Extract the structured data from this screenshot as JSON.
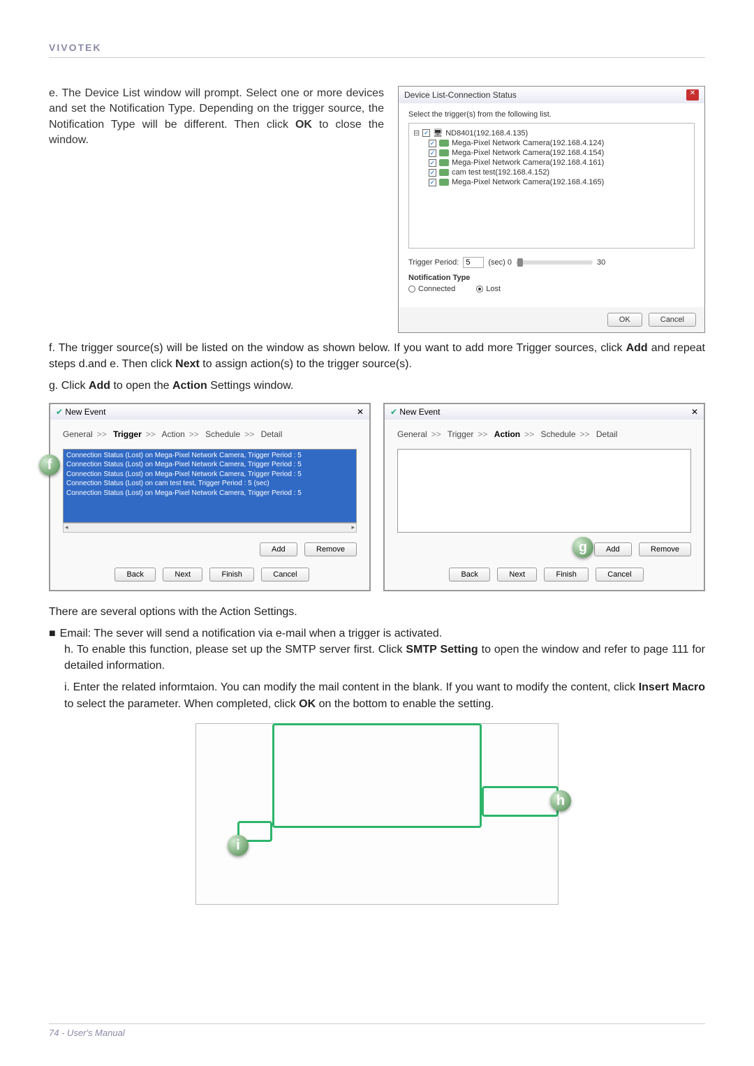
{
  "header": {
    "brand": "VIVOTEK"
  },
  "para_e": {
    "prefix": "e. The Device List window will prompt. Select one or more devices and set the Notification Type. Depending on the trigger source, the Notification Type will be different. Then click ",
    "ok": "OK",
    "suffix": " to close the window."
  },
  "device_dialog": {
    "title": "Device List-Connection Status",
    "instruction": "Select the trigger(s) from the following list.",
    "root": "ND8401(192.168.4.135)",
    "items": [
      "Mega-Pixel Network Camera(192.168.4.124)",
      "Mega-Pixel Network Camera(192.168.4.154)",
      "Mega-Pixel Network Camera(192.168.4.161)",
      "cam test test(192.168.4.152)",
      "Mega-Pixel Network Camera(192.168.4.165)"
    ],
    "trigger_period_label": "Trigger Period:",
    "trigger_period_value": "5",
    "sec_label": "(sec)  0",
    "slider_max": "30",
    "notification_label": "Notification Type",
    "radio_connected": "Connected",
    "radio_lost": "Lost",
    "ok": "OK",
    "cancel": "Cancel"
  },
  "para_f": {
    "prefix": "f. The trigger source(s) will be listed on the window as shown below. If you want to add more Trigger sources, click ",
    "add": "Add",
    "mid": " and repeat steps d.and e. Then click ",
    "next": "Next",
    "suffix": " to assign action(s) to the trigger source(s)."
  },
  "para_g": {
    "prefix": "g. Click ",
    "add": "Add",
    "mid": " to open the ",
    "action": "Action",
    "suffix": " Settings window."
  },
  "wizard": {
    "title": "New Event",
    "crumbs": [
      "General",
      "Trigger",
      "Action",
      "Schedule",
      "Detail"
    ],
    "sep": ">>",
    "trigger_rows": [
      "Connection Status (Lost)  on Mega-Pixel Network Camera, Trigger Period : 5",
      "Connection Status (Lost)  on Mega-Pixel Network Camera, Trigger Period : 5",
      "Connection Status (Lost)  on Mega-Pixel Network Camera, Trigger Period : 5",
      "Connection Status (Lost)  on cam test test, Trigger Period : 5 (sec)",
      "Connection Status (Lost)  on Mega-Pixel Network Camera, Trigger Period : 5"
    ],
    "add": "Add",
    "remove": "Remove",
    "back": "Back",
    "next": "Next",
    "finish": "Finish",
    "cancel": "Cancel"
  },
  "lower_text": {
    "l1": "There are several options with the Action Settings.",
    "l2": "Email: The sever will send a notification via e-mail when a trigger is activated.",
    "h_prefix": "h. To enable this function, please set up the SMTP server first. Click ",
    "h_bold": "SMTP Setting",
    "h_suffix": " to open the window and refer to page 111 for detailed information.",
    "i_prefix": "i. Enter the related informtaion. You can modify the mail content in the blank. If you want to modify the content, click ",
    "i_bold1": "Insert Macro",
    "i_mid": " to select the parameter. When completed, click ",
    "i_bold2": "OK",
    "i_suffix": " on the bottom to enable the setting."
  },
  "circles": {
    "f": "f",
    "g": "g",
    "h": "h",
    "i": "i"
  },
  "footer": {
    "page": "74 - User's Manual"
  }
}
